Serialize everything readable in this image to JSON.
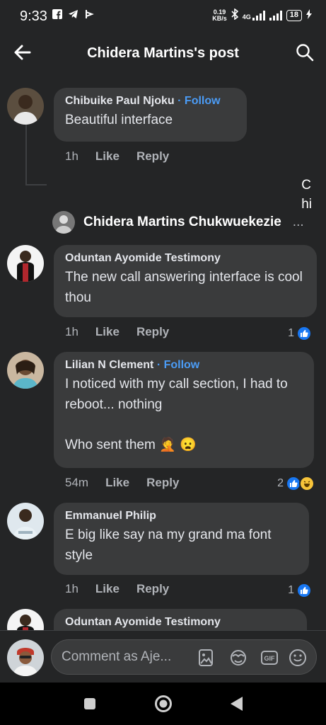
{
  "status_bar": {
    "time": "9:33",
    "left_icons": [
      "facebook-icon",
      "telegram-icon",
      "maps-icon"
    ],
    "net_speed_value": "0.19",
    "net_speed_unit": "KB/s",
    "network": "4G",
    "battery": "18"
  },
  "header": {
    "title": "Chidera Martins's post"
  },
  "comments": [
    {
      "author": "Chibuike Paul Njoku",
      "follow": "· Follow",
      "text": "Beautiful interface",
      "time": "1h",
      "like": "Like",
      "reply": "Reply"
    },
    {
      "author": "Oduntan Ayomide Testimony",
      "text": "The new call answering interface is cool thou",
      "time": "1h",
      "like": "Like",
      "reply": "Reply",
      "reactions": "1"
    },
    {
      "author": "Lilian N Clement",
      "follow": "· Follow",
      "text_line1": "I noticed with my call section, I had to reboot... nothing",
      "text_line2": "Who sent them 🤦 😦",
      "time": "54m",
      "like": "Like",
      "reply": "Reply",
      "reactions": "2"
    },
    {
      "author": "Emmanuel Philip",
      "text": "E big like say na my grand ma font style",
      "time": "1h",
      "like": "Like",
      "reply": "Reply",
      "reactions": "1"
    },
    {
      "author": "Oduntan Ayomide Testimony"
    }
  ],
  "reply_preview": {
    "name": "Chidera Martins Chukwuekezie",
    "ellipsis": "...",
    "side_text_line1": "C",
    "side_text_line2": "hi"
  },
  "composer": {
    "placeholder": "Comment as Aje..."
  },
  "colors": {
    "background": "#242526",
    "bubble": "#3a3b3c",
    "accent": "#4b9cf6",
    "like_blue": "#1877f2"
  }
}
